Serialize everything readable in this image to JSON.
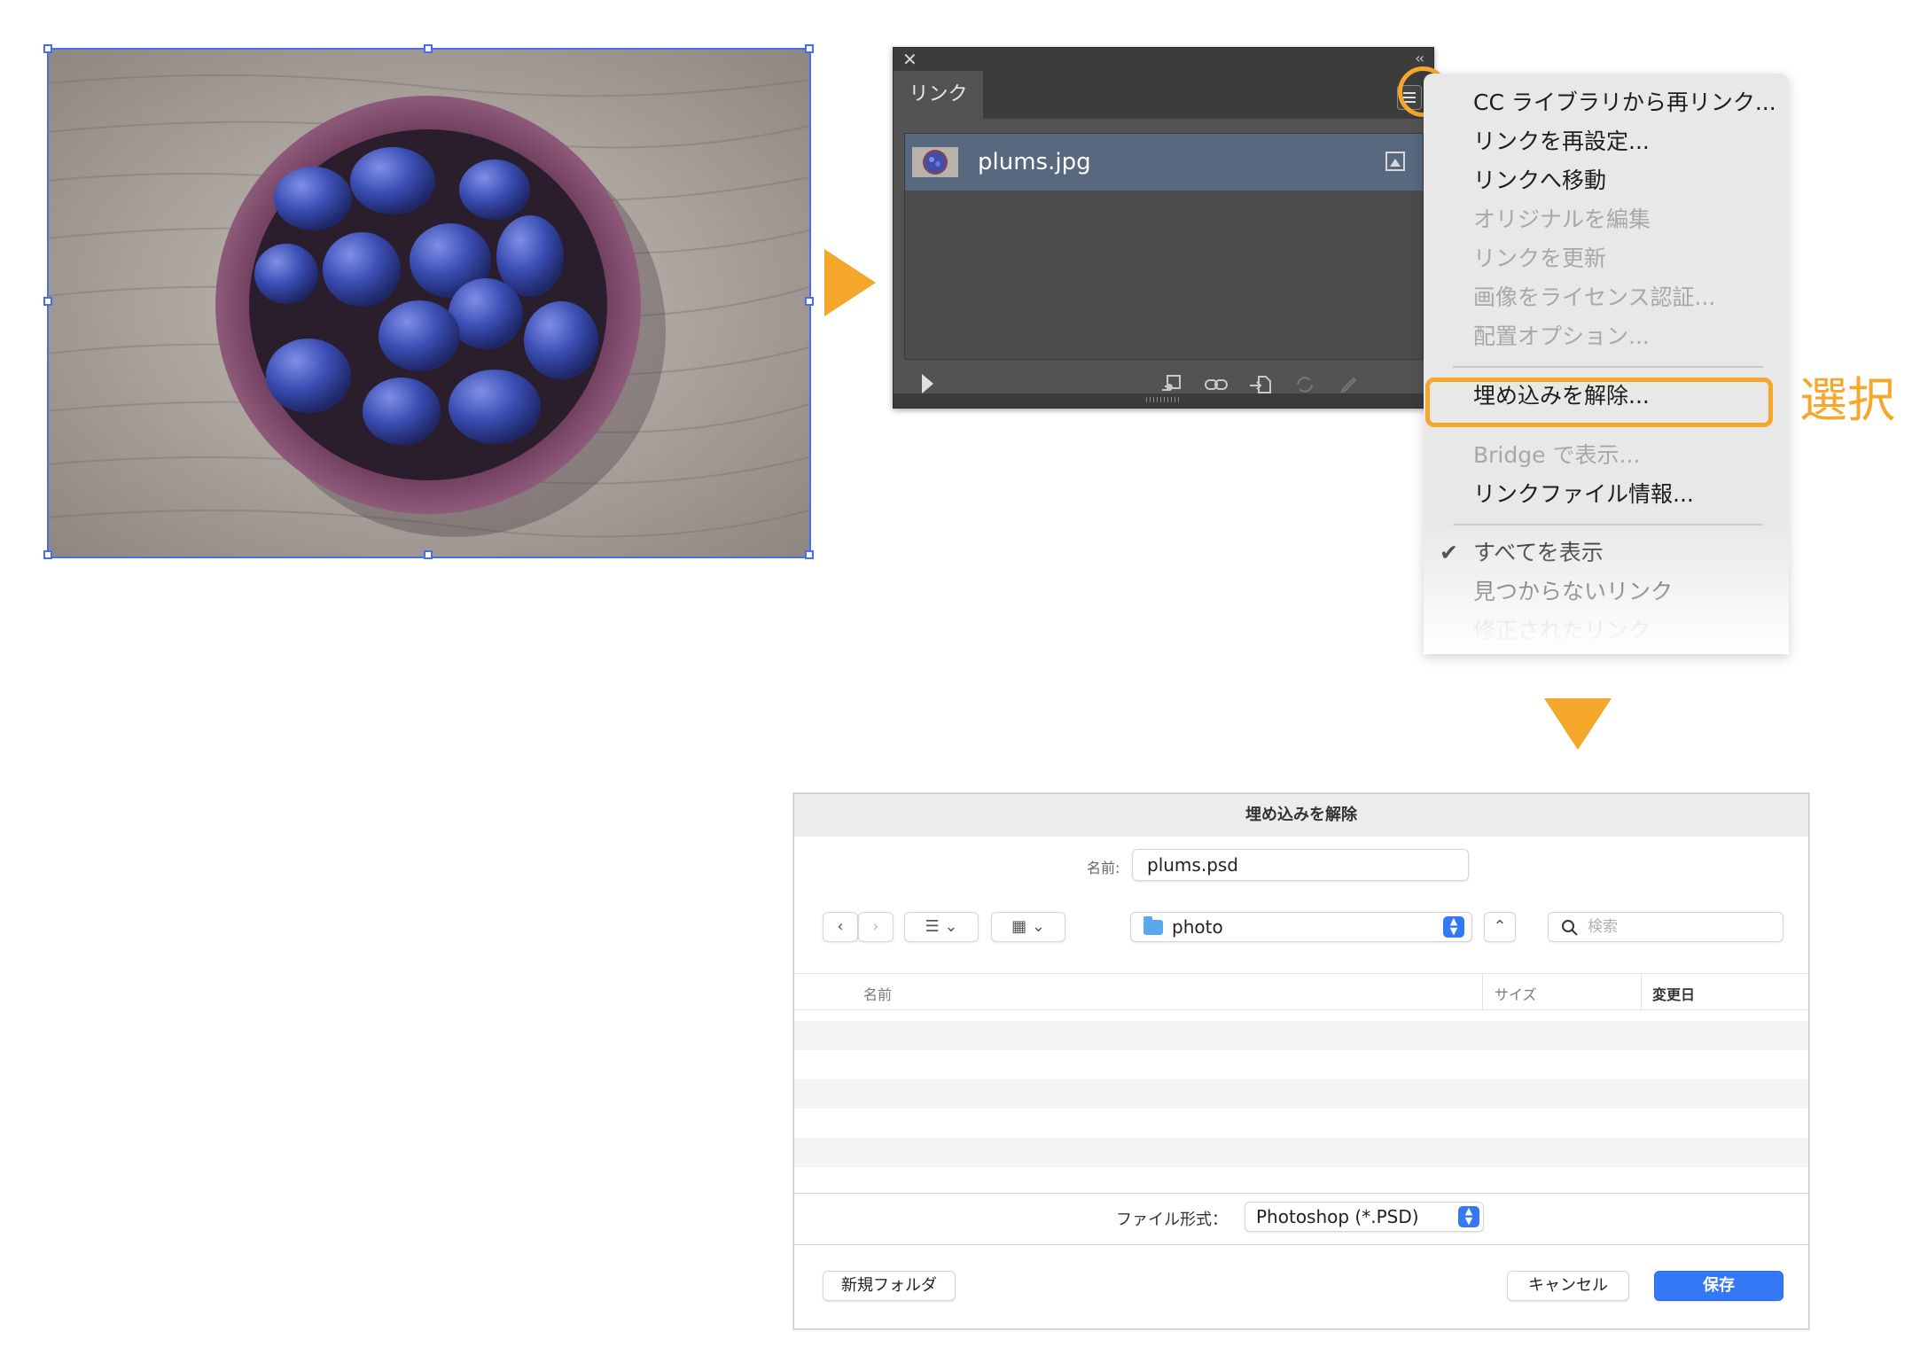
{
  "image": {
    "subject": "plums in a purple ceramic bowl on a wooden table"
  },
  "colors": {
    "accent": "#f5a72c",
    "selection": "#4a6cf0",
    "primary_button": "#3478f6"
  },
  "links_panel": {
    "tab": "リンク",
    "icons": [
      "close-icon",
      "collapse-icon",
      "panel-menu-icon"
    ],
    "items": [
      {
        "name": "plums.jpg",
        "status_icon": "embedded-icon"
      }
    ],
    "toolbar_icons": [
      "show-details-icon",
      "relink-from-cc-icon",
      "relink-icon",
      "go-to-link-icon",
      "update-link-icon",
      "edit-original-icon"
    ]
  },
  "flyout_menu": {
    "items": [
      {
        "label": "CC ライブラリから再リンク...",
        "enabled": true
      },
      {
        "label": "リンクを再設定...",
        "enabled": true
      },
      {
        "label": "リンクへ移動",
        "enabled": true
      },
      {
        "label": "オリジナルを編集",
        "enabled": false
      },
      {
        "label": "リンクを更新",
        "enabled": false
      },
      {
        "label": "画像をライセンス認証...",
        "enabled": false
      },
      {
        "label": "配置オプション...",
        "enabled": false
      },
      {
        "label": "埋め込みを解除...",
        "enabled": true,
        "highlighted": true
      },
      {
        "label": "Bridge で表示...",
        "enabled": false
      },
      {
        "label": "リンクファイル情報...",
        "enabled": true
      },
      {
        "label": "すべてを表示",
        "enabled": true,
        "checked": true
      },
      {
        "label": "見つからないリンク",
        "enabled": true
      },
      {
        "label": "修正されたリンク",
        "enabled": false
      }
    ]
  },
  "annotation": {
    "select_label": "選択"
  },
  "save_dialog": {
    "title": "埋め込みを解除",
    "name_label": "名前:",
    "filename": "plums.psd",
    "location": "photo",
    "search_placeholder": "検索",
    "columns": {
      "name": "名前",
      "size": "サイズ",
      "modified": "変更日"
    },
    "format_label": "ファイル形式：",
    "format_value": "Photoshop (*.PSD)",
    "new_folder": "新規フォルダ",
    "cancel": "キャンセル",
    "save": "保存"
  }
}
